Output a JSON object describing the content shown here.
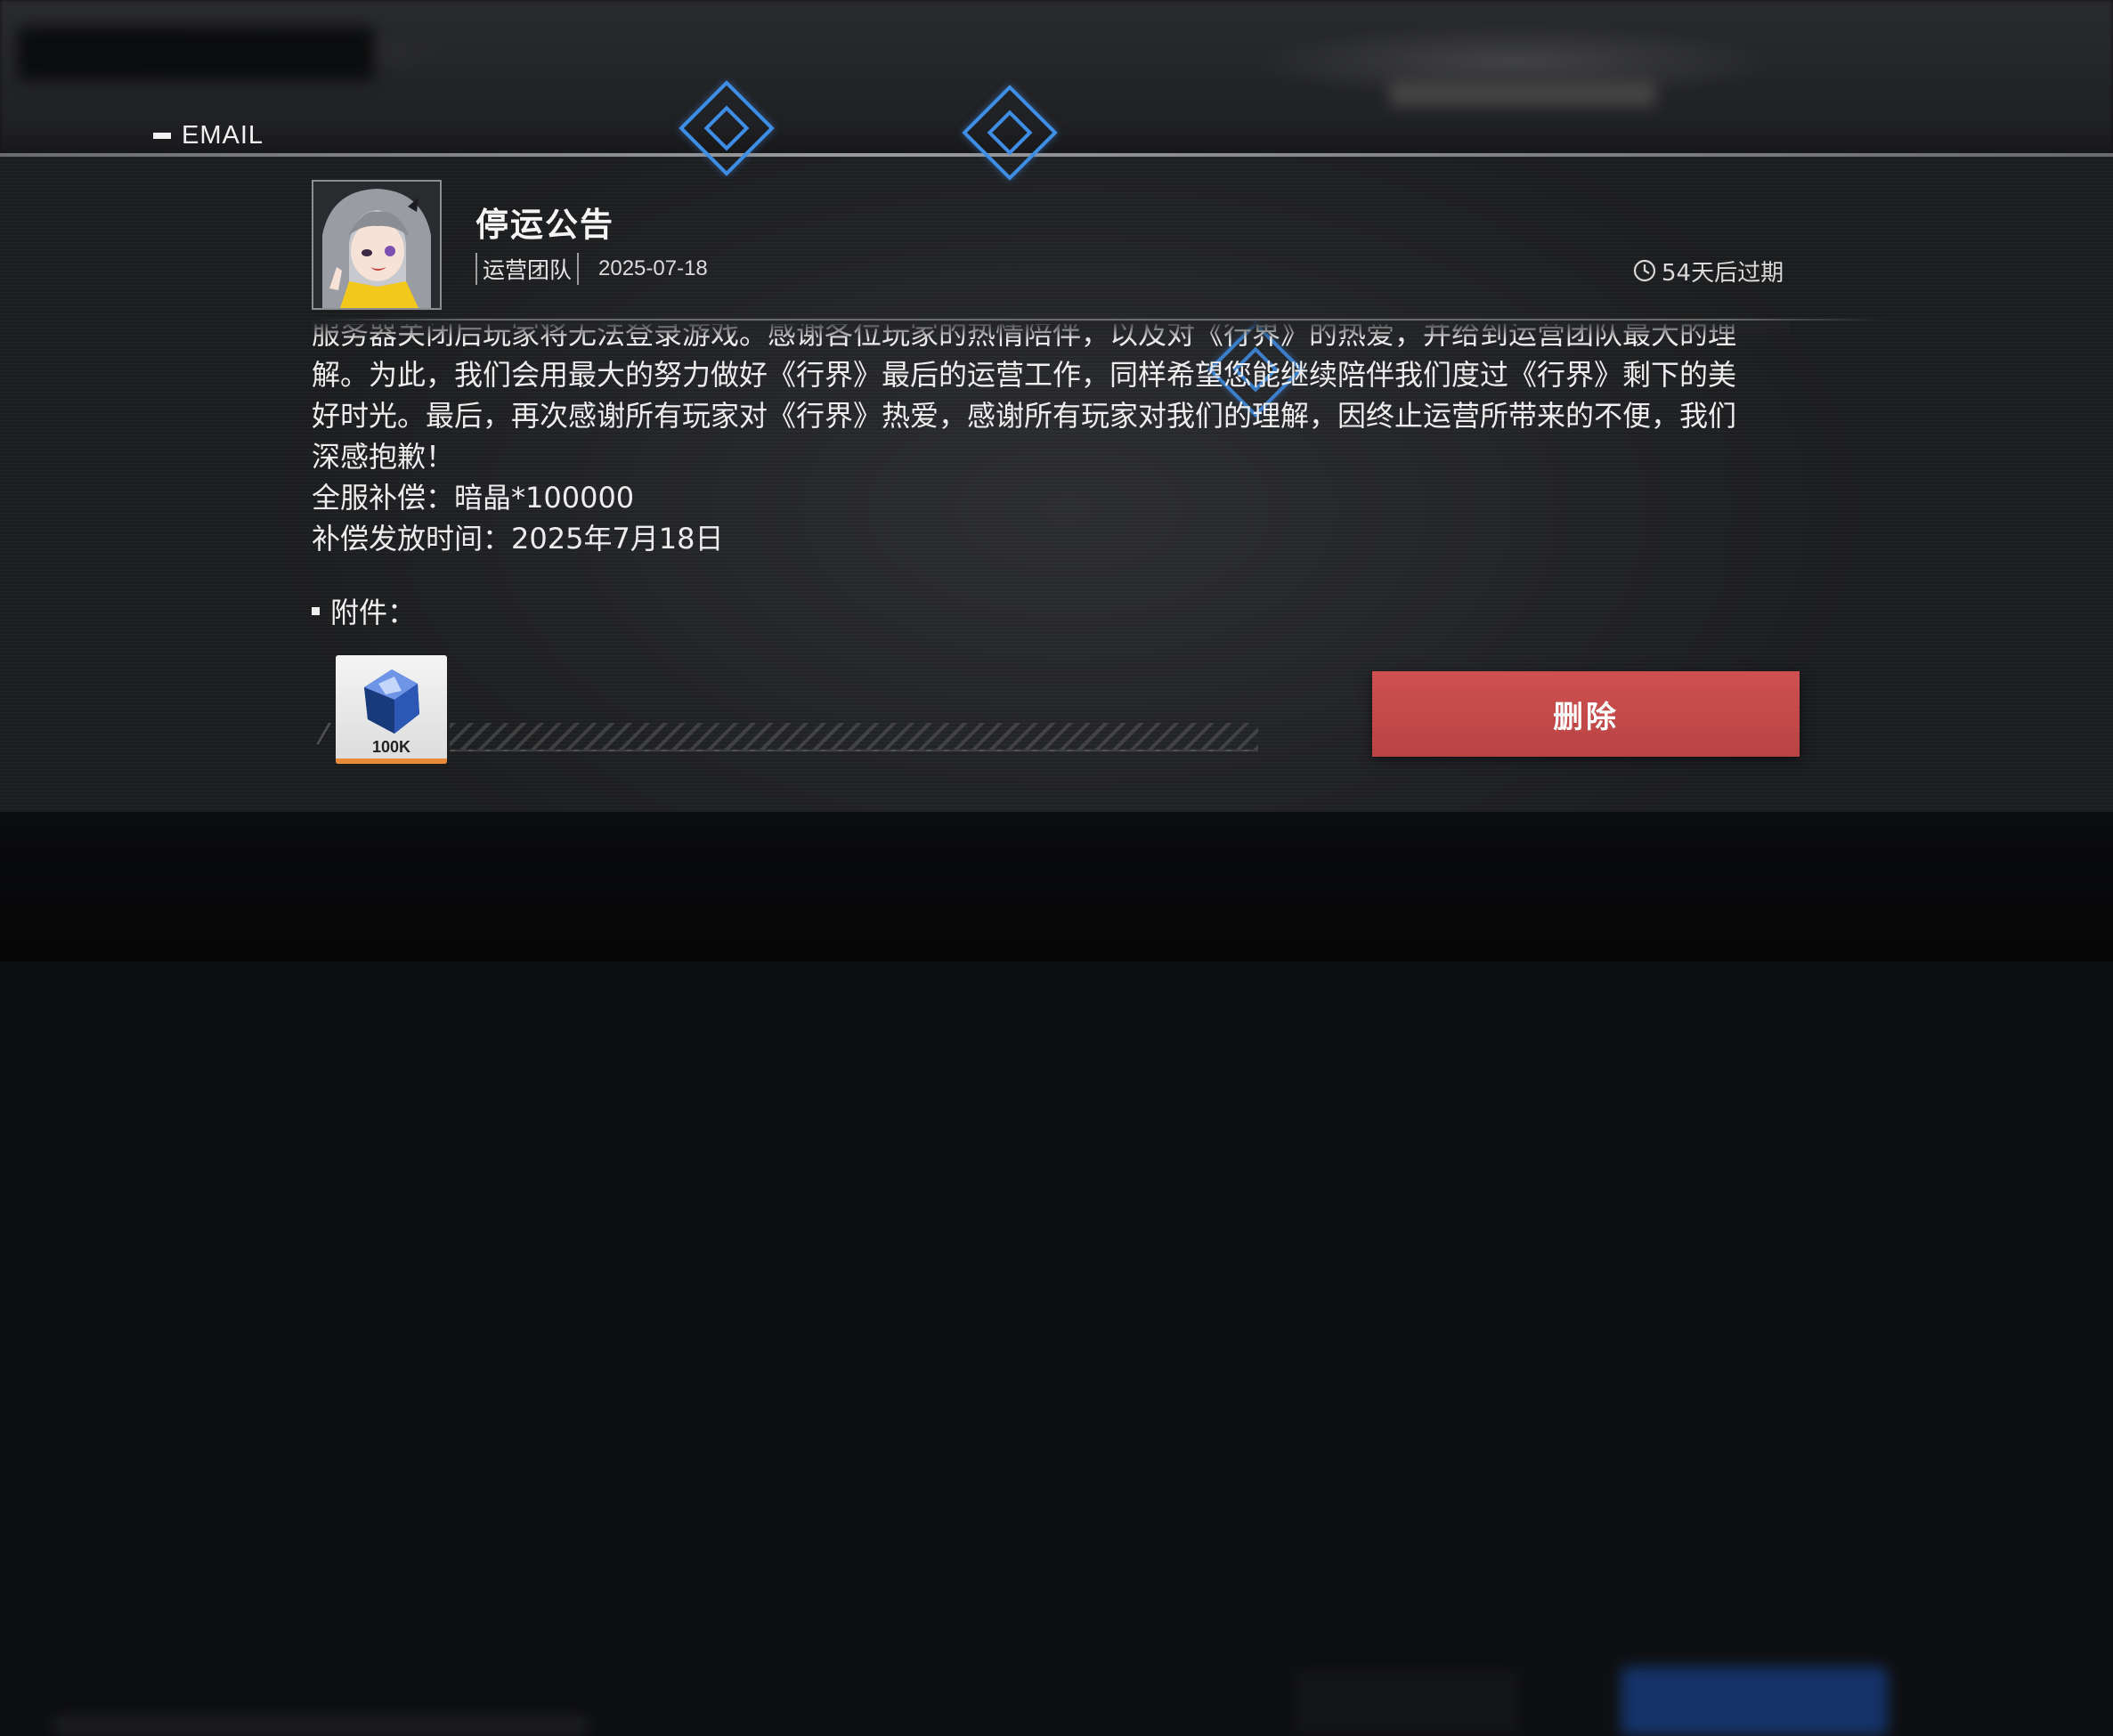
{
  "header": {
    "section_title": "EMAIL"
  },
  "mail": {
    "subject": "停运公告",
    "sender": "运营团队",
    "date": "2025-07-18",
    "expire_text": "54天后过期",
    "body_lines": [
      "服务器关闭后玩家将无法登录游戏。感谢各位玩家的热情陪伴，以及对《行界》的热爱，并给到运营团队最大的理",
      "解。为此，我们会用最大的努力做好《行界》最后的运营工作，同样希望您能继续陪伴我们度过《行界》剩下的美",
      "好时光。最后，再次感谢所有玩家对《行界》热爱，感谢所有玩家对我们的理解，因终止运营所带来的不便，我们",
      "深感抱歉！",
      "全服补偿：暗晶*100000",
      "补偿发放时间：2025年7月18日"
    ]
  },
  "attachments": {
    "label": "附件：",
    "items": [
      {
        "icon": "dark-crystal-icon",
        "quantity": "100K"
      }
    ]
  },
  "actions": {
    "delete_label": "删除"
  },
  "colors": {
    "accent_blue": "#3f8ee6",
    "delete_red": "#c44a4a",
    "item_rarity_bar": "#e98a3a"
  }
}
